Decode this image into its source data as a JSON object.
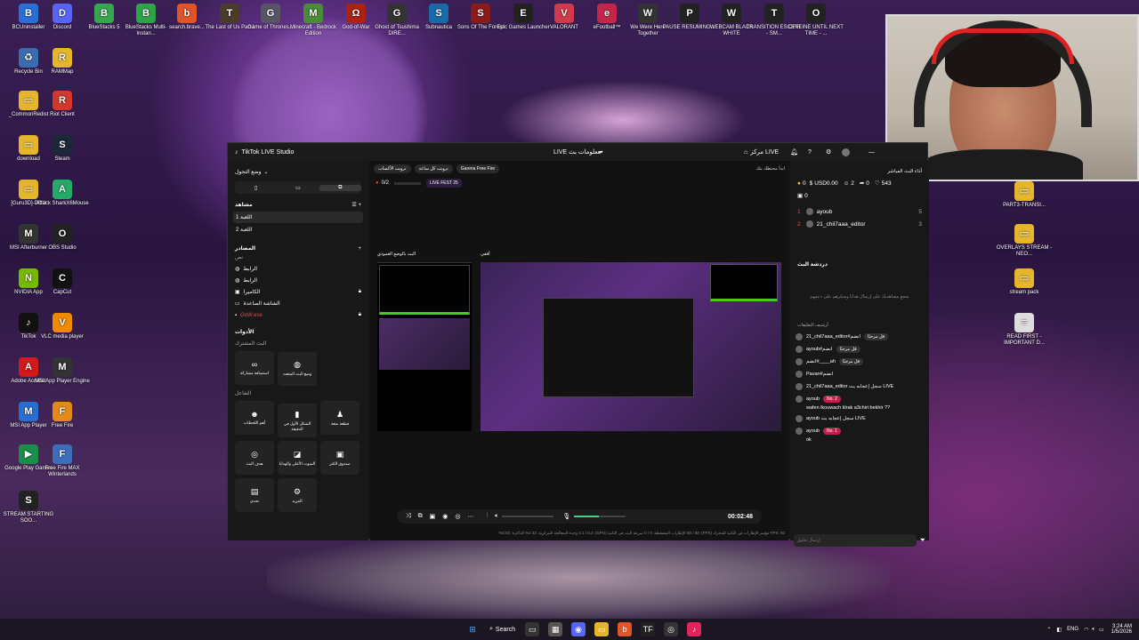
{
  "desktop_icons": [
    {
      "label": "BCUninstaller",
      "glyph": "B",
      "color": "#2b6fd6"
    },
    {
      "label": "Discord",
      "glyph": "D",
      "color": "#5865f2"
    },
    {
      "label": "BlueStacks 5",
      "glyph": "B",
      "color": "#36a64f"
    },
    {
      "label": "BlueStacks Multi-Instan...",
      "glyph": "B",
      "color": "#2fa24a"
    },
    {
      "label": "search.brave...",
      "glyph": "b",
      "color": "#e0542a"
    },
    {
      "label": "The Last of Us Part I",
      "glyph": "T",
      "color": "#4a3b2b"
    },
    {
      "label": "Game of Thrones...",
      "glyph": "G",
      "color": "#556"
    },
    {
      "label": "Minecraft - Bedrock Edition",
      "glyph": "M",
      "color": "#4a8b3a"
    },
    {
      "label": "God-of-War",
      "glyph": "Ω",
      "color": "#a21"
    },
    {
      "label": "Ghost of Tsushima DIRE...",
      "glyph": "G",
      "color": "#333"
    },
    {
      "label": "Subnautica",
      "glyph": "S",
      "color": "#1b6aa8"
    },
    {
      "label": "Sons Of The Forest",
      "glyph": "S",
      "color": "#8b1a1a"
    },
    {
      "label": "Epic Games Launcher",
      "glyph": "E",
      "color": "#222"
    },
    {
      "label": "VALORANT",
      "glyph": "V",
      "color": "#d13a4a"
    },
    {
      "label": "eFootball™",
      "glyph": "e",
      "color": "#c2264a"
    },
    {
      "label": "We Were Here Together",
      "glyph": "W",
      "color": "#333"
    },
    {
      "label": "PAUSE RESUMING ...",
      "glyph": "P",
      "color": "#222"
    },
    {
      "label": "WEBCAM BLACK WHITE",
      "glyph": "W",
      "color": "#222"
    },
    {
      "label": "TRANSITION ESCENE - SM...",
      "glyph": "T",
      "color": "#222"
    },
    {
      "label": "OFFLINE UNTIL NEXT TIME - ...",
      "glyph": "O",
      "color": "#222"
    },
    {
      "label": "Recycle Bin",
      "glyph": "♻",
      "color": "#3a6db0"
    },
    {
      "label": "RAMMap",
      "glyph": "R",
      "color": "#e5b52c"
    },
    {
      "label": "_CommonRedist",
      "glyph": "▭",
      "color": "#e5b52c"
    },
    {
      "label": "Riot Client",
      "glyph": "R",
      "color": "#d13a2a"
    },
    {
      "label": "download",
      "glyph": "▭",
      "color": "#e5b52c"
    },
    {
      "label": "Steam",
      "glyph": "S",
      "color": "#1b2838"
    },
    {
      "label": "[Guru3D]-DDU",
      "glyph": "▭",
      "color": "#e5b52c"
    },
    {
      "label": "Attack SharkX6Mouse",
      "glyph": "A",
      "color": "#2a6"
    },
    {
      "label": "MSI Afterburner",
      "glyph": "M",
      "color": "#333"
    },
    {
      "label": "OBS Studio",
      "glyph": "O",
      "color": "#222"
    },
    {
      "label": "NVIDIA App",
      "glyph": "N",
      "color": "#76b900"
    },
    {
      "label": "CapCut",
      "glyph": "C",
      "color": "#111"
    },
    {
      "label": "TikTok",
      "glyph": "♪",
      "color": "#111"
    },
    {
      "label": "VLC media player",
      "glyph": "V",
      "color": "#f08a00"
    },
    {
      "label": "Adobe Acrobat",
      "glyph": "A",
      "color": "#d4191c"
    },
    {
      "label": "MSI App Player Engine",
      "glyph": "M",
      "color": "#333"
    },
    {
      "label": "MSI App Player",
      "glyph": "M",
      "color": "#2a6fd0"
    },
    {
      "label": "Free Fire",
      "glyph": "F",
      "color": "#e38a1b"
    },
    {
      "label": "Google Play Games",
      "glyph": "▶",
      "color": "#1a8f4a"
    },
    {
      "label": "Free Fire MAX Winterlands",
      "glyph": "F",
      "color": "#3b6fb8"
    },
    {
      "label": "STREAM STARTING SOO...",
      "glyph": "S",
      "color": "#222"
    },
    {
      "label": "PART3-TRANSI...",
      "glyph": "▭",
      "color": "#e5b52c"
    },
    {
      "label": "OVERLAYS STREAM - NEO...",
      "glyph": "▭",
      "color": "#e5b52c"
    },
    {
      "label": "stream pack",
      "glyph": "▭",
      "color": "#e5b52c"
    },
    {
      "label": "READ FIRST - IMPORTANT D...",
      "glyph": "≡",
      "color": "#ddd"
    }
  ],
  "window": {
    "title": "TikTok LIVE Studio",
    "center_title": "LIVE معلومات بث",
    "go_live": "مركز LIVE",
    "layout_mode": "وضع التحول"
  },
  "left": {
    "scenes_title": "مشاهد",
    "scenes": [
      "اللعبة 1",
      "اللعبة 2"
    ],
    "sources_title": "المصادر",
    "sources_sub": "نص",
    "sources": [
      "الرابط",
      "الرابط",
      "الكاميرا",
      "الشاشة الصاعدة",
      "GoW.exe"
    ],
    "tools_title": "الأدوات",
    "tools_sub": "البث المشترك",
    "tools_a": [
      {
        "label": "استضافة مشاركة",
        "glyph": "∞"
      },
      {
        "label": "وضع البث المتعدد",
        "glyph": "◍"
      }
    ],
    "interact_title": "التفاعل",
    "tools_b": [
      {
        "label": "أهم اللحظات",
        "glyph": "☻"
      },
      {
        "label": "الشكل الأول في الدقيقة",
        "glyph": "▮"
      },
      {
        "label": "قطعة متعة",
        "glyph": "♟"
      },
      {
        "label": "هدف البث",
        "glyph": "◎"
      },
      {
        "label": "الصوت الأعلى والهدايا",
        "glyph": "◪"
      },
      {
        "label": "صندوق الكنز",
        "glyph": "▣"
      },
      {
        "label": "تحدي",
        "glyph": "▤"
      },
      {
        "label": "المزيد",
        "glyph": "⚙"
      }
    ]
  },
  "center": {
    "chips": [
      "Garena Free Fire",
      "ترويب كل ساعة",
      "ترويب الأكساب"
    ],
    "hint": "ابدأ محتطك بثك",
    "goal_count": "0/2",
    "badge_text": "LIVE FEST 25",
    "preview_label_left": "البث بالوضع العمودي",
    "preview_label_right": "أفقي",
    "timer": "00:02:48",
    "stats": "FPS: 60   مؤشر الإطارات في الثانية للمحرك (FPS): 60 / 60   الإطارات المسقطة: 0 / 0   سرعة البت في الثانية (GPU): 4.1 / 5.3   وحدة المعالجة المركزية: 2.33%   الذاكرة: 0.53%"
  },
  "right": {
    "header": "أداء البث المباشر",
    "stats": {
      "coins": "0",
      "usd": "USD0.00",
      "viewers": "2",
      "shares": "0",
      "likes": "543",
      "gifts": "0"
    },
    "top_viewers": [
      {
        "rank": "1",
        "name": "ayoub",
        "score": "5"
      },
      {
        "rank": "2",
        "name": "21_chil7aaa_editor",
        "score": "3"
      }
    ],
    "chat_title": "دردشة البث",
    "chat_empty": "شجع مشاهديك على إرسال هدايا وشكرهم على دعمهم",
    "comments_header": "أرشيف التعليقات",
    "comments": [
      {
        "name": "21_chil7aaa_editor#انضم",
        "pill": "قل مرحبًا"
      },
      {
        "name": "ayoub#انضم",
        "pill": "قل مرحبًا"
      },
      {
        "name": "انضم#____ah",
        "pill": "قل مرحبًا"
      },
      {
        "name": "Pavan#انضم",
        "pill": ""
      },
      {
        "name": "21_chil7aaa_editor سجل إعجابه بث LIVE",
        "pill": ""
      },
      {
        "name": "ayoub",
        "pill": "No. 2",
        "msg": "wafen lkouwach klrak a3chiri bekhir ??"
      },
      {
        "name": "ayoub سجل إعجابه بث LIVE",
        "pill": ""
      },
      {
        "name": "ayoub",
        "pill": "No. 1",
        "msg": "ok"
      }
    ],
    "input_placeholder": "إرسال تعليق"
  },
  "taskbar": {
    "search": "Search",
    "lang": "ENG",
    "time": "3:24 AM",
    "date": "1/5/2026"
  }
}
